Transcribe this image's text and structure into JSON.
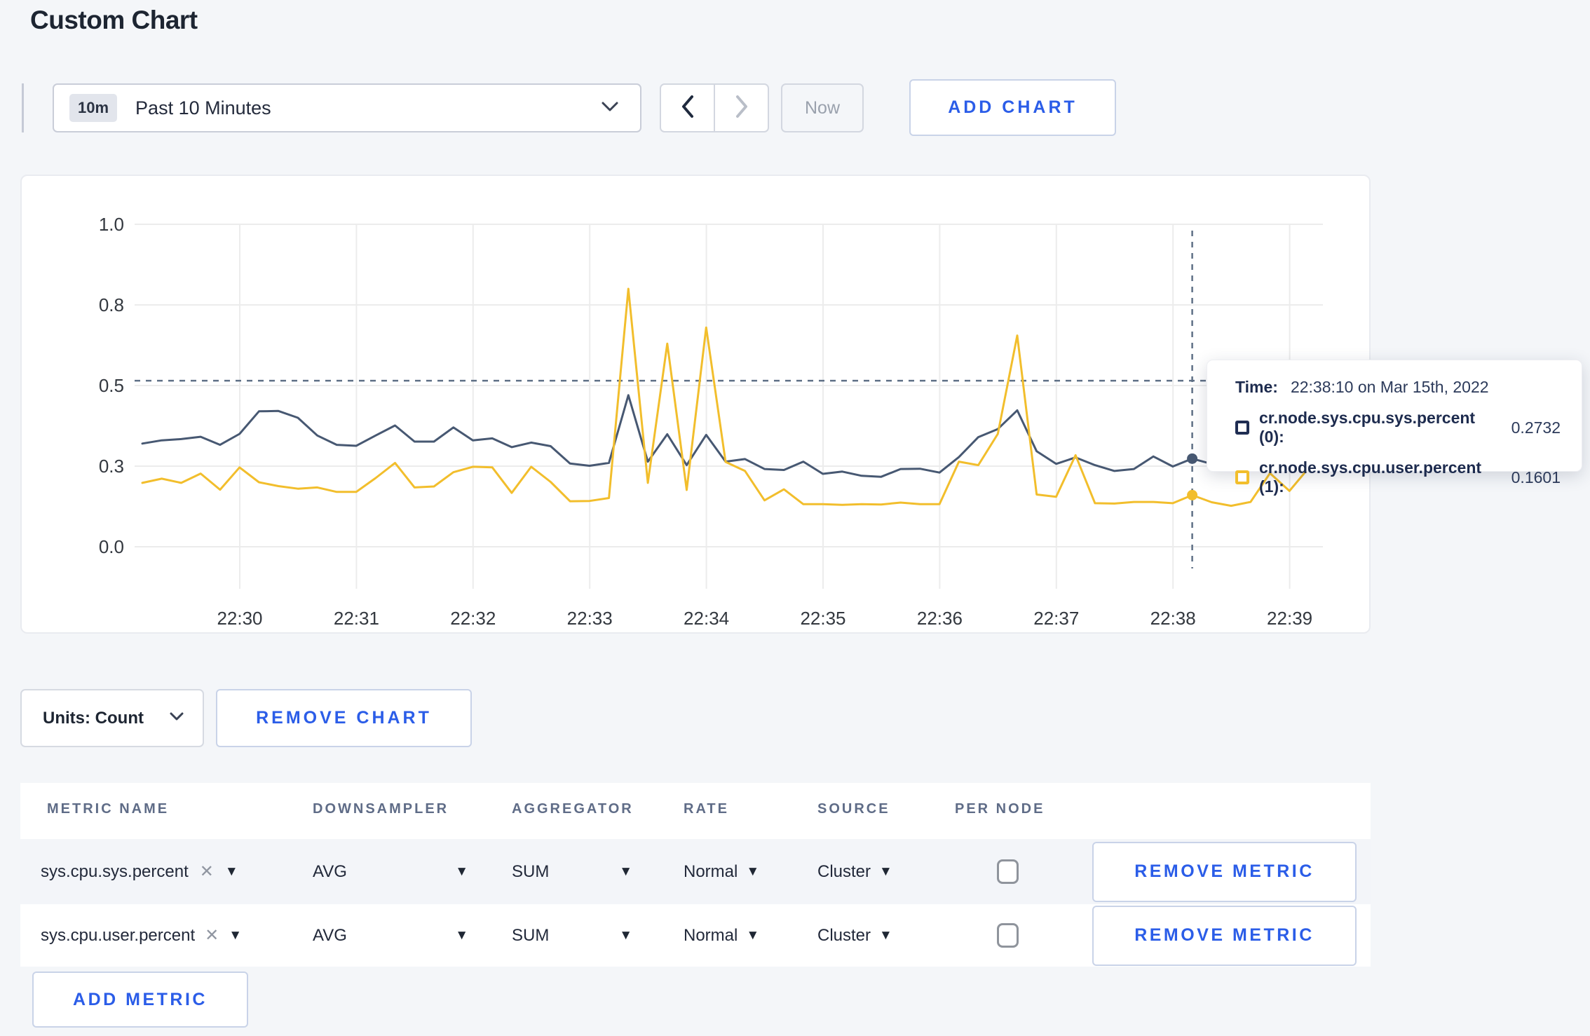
{
  "page": {
    "title": "Custom Chart",
    "background": "#f4f6f9",
    "accent_blue": "#2b5de8"
  },
  "toolbar": {
    "time_badge": "10m",
    "time_label": "Past 10 Minutes",
    "now_label": "Now",
    "add_chart_label": "ADD CHART"
  },
  "tooltip": {
    "time_label": "Time:",
    "time_value": "22:38:10 on Mar 15th, 2022",
    "rows": [
      {
        "label": "cr.node.sys.cpu.sys.percent (0):",
        "value": "0.2732",
        "color": "#1f2d52"
      },
      {
        "label": "cr.node.sys.cpu.user.percent (1):",
        "value": "0.1601",
        "color": "#f2be2c"
      }
    ]
  },
  "chart_controls": {
    "units_label": "Units: Count",
    "remove_chart_label": "REMOVE CHART"
  },
  "metrics_table": {
    "headers": [
      "METRIC NAME",
      "DOWNSAMPLER",
      "AGGREGATOR",
      "RATE",
      "SOURCE",
      "PER NODE"
    ],
    "rows": [
      {
        "metric": "sys.cpu.sys.percent",
        "downsampler": "AVG",
        "aggregator": "SUM",
        "rate": "Normal",
        "source": "Cluster",
        "per_node_checked": false,
        "remove_label": "REMOVE METRIC"
      },
      {
        "metric": "sys.cpu.user.percent",
        "downsampler": "AVG",
        "aggregator": "SUM",
        "rate": "Normal",
        "source": "Cluster",
        "per_node_checked": false,
        "remove_label": "REMOVE METRIC"
      }
    ],
    "add_metric_label": "ADD METRIC"
  },
  "chart_data": {
    "type": "line",
    "title": "",
    "x_start": "22:29:10",
    "x_interval_seconds": 10,
    "x_tick_labels": [
      "22:30",
      "22:31",
      "22:32",
      "22:33",
      "22:34",
      "22:35",
      "22:36",
      "22:37",
      "22:38",
      "22:39"
    ],
    "y_ticks": [
      0,
      0.25,
      0.5,
      0.75,
      1.0
    ],
    "y_tick_labels": [
      "0.0",
      "0.3",
      "0.5",
      "0.8",
      "1.0"
    ],
    "ylim": [
      0,
      1
    ],
    "grid": true,
    "grid_color": "#ececec",
    "legend_position": "tooltip",
    "series": [
      {
        "name": "cr.node.sys.cpu.sys.percent",
        "color": "#475872",
        "values": [
          0.32,
          0.33,
          0.334,
          0.341,
          0.316,
          0.35,
          0.42,
          0.421,
          0.4,
          0.345,
          0.316,
          0.313,
          0.345,
          0.376,
          0.326,
          0.326,
          0.37,
          0.33,
          0.336,
          0.309,
          0.323,
          0.312,
          0.258,
          0.251,
          0.26,
          0.47,
          0.264,
          0.349,
          0.253,
          0.347,
          0.264,
          0.272,
          0.241,
          0.238,
          0.264,
          0.226,
          0.233,
          0.22,
          0.217,
          0.241,
          0.242,
          0.23,
          0.278,
          0.34,
          0.365,
          0.423,
          0.296,
          0.257,
          0.277,
          0.253,
          0.235,
          0.241,
          0.28,
          0.249,
          0.2732,
          0.257,
          0.3,
          0.31,
          0.3,
          0.305,
          0.3
        ]
      },
      {
        "name": "cr.node.sys.cpu.user.percent",
        "color": "#f2be2c",
        "values": [
          0.198,
          0.211,
          0.198,
          0.227,
          0.177,
          0.246,
          0.2,
          0.188,
          0.18,
          0.184,
          0.17,
          0.17,
          0.213,
          0.26,
          0.184,
          0.187,
          0.231,
          0.248,
          0.246,
          0.167,
          0.248,
          0.201,
          0.141,
          0.142,
          0.151,
          0.8,
          0.198,
          0.63,
          0.176,
          0.68,
          0.263,
          0.235,
          0.144,
          0.178,
          0.132,
          0.132,
          0.13,
          0.132,
          0.131,
          0.137,
          0.132,
          0.132,
          0.264,
          0.253,
          0.35,
          0.655,
          0.162,
          0.155,
          0.284,
          0.135,
          0.134,
          0.139,
          0.139,
          0.135,
          0.1601,
          0.138,
          0.127,
          0.139,
          0.228,
          0.173,
          0.245
        ]
      }
    ],
    "crosshair": {
      "x_time": "22:38:10",
      "point_index": 54,
      "hline_value": 0.515,
      "color": "#5f7086",
      "points": [
        0.2732,
        0.1601
      ]
    }
  }
}
